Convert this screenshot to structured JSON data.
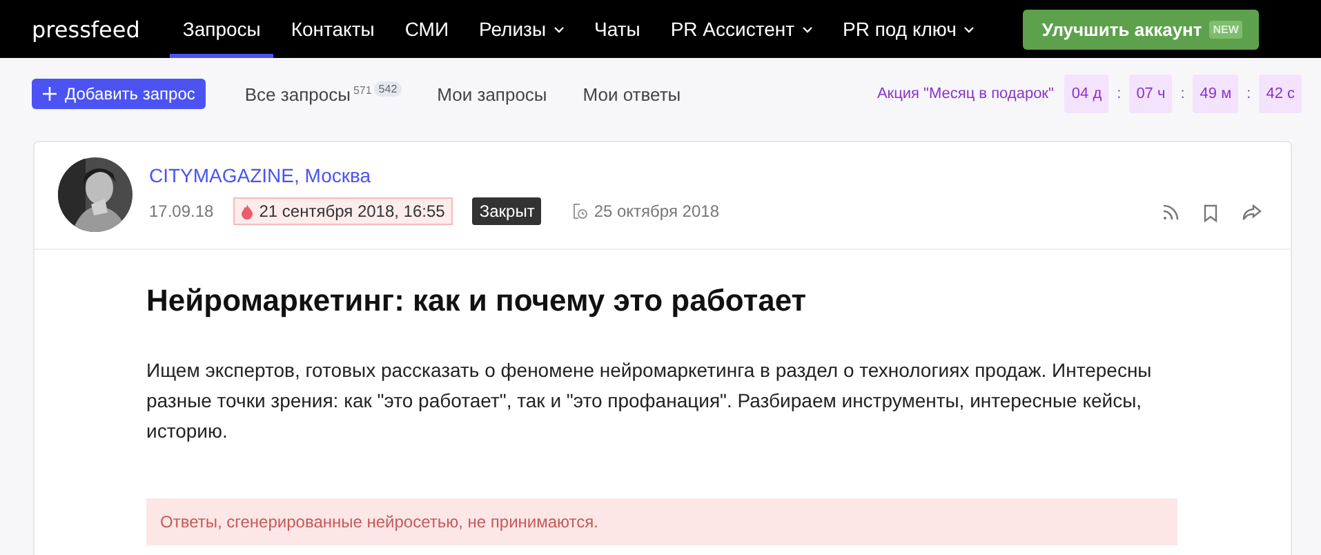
{
  "logo": "pressfeed",
  "nav": [
    {
      "label": "Запросы",
      "selected": true,
      "dropdown": false
    },
    {
      "label": "Контакты",
      "selected": false,
      "dropdown": false
    },
    {
      "label": "СМИ",
      "selected": false,
      "dropdown": false
    },
    {
      "label": "Релизы",
      "selected": false,
      "dropdown": true
    },
    {
      "label": "Чаты",
      "selected": false,
      "dropdown": false
    },
    {
      "label": "PR Ассистент",
      "selected": false,
      "dropdown": true
    },
    {
      "label": "PR под ключ",
      "selected": false,
      "dropdown": true
    }
  ],
  "upgrade_button": {
    "label": "Улучшить аккаунт",
    "badge": "NEW"
  },
  "add_button": "Добавить запрос",
  "tabs": [
    {
      "label": "Все запросы",
      "count": "571",
      "new_count": "542"
    },
    {
      "label": "Мои запросы"
    },
    {
      "label": "Мои ответы"
    }
  ],
  "promo": {
    "label": "Акция \"Месяц в подарок\"",
    "timer": [
      "04 д",
      "07 ч",
      "49 м",
      "42 с"
    ],
    "separator": ":"
  },
  "request": {
    "outlet": "CITYMAGAZINE, Москва",
    "published": "17.09.18",
    "deadline": "21 сентября 2018, 16:55",
    "status": "Закрыт",
    "closed_date": "25 октября 2018",
    "title": "Нейромаркетинг: как и почему это работает",
    "body": "Ищем экспертов, готовых рассказать о феномене нейромаркетинга в раздел о технологиях продаж. Интересны разные точки зрения: как \"это работает\", так и \"это профанация\". Разбираем инструменты, интересные кейсы, историю.",
    "notice": "Ответы, сгенерированные нейросетью, не принимаются."
  }
}
